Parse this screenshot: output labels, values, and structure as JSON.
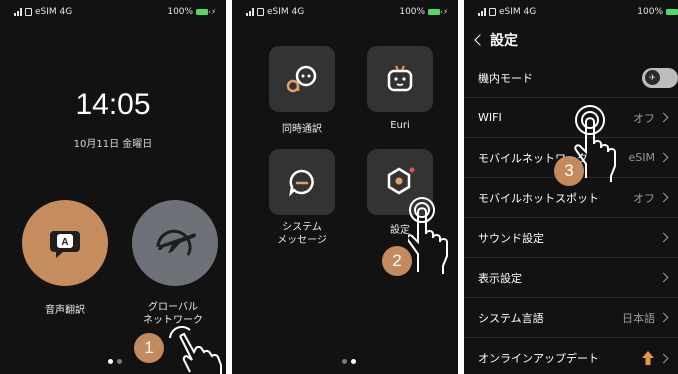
{
  "status": {
    "carrier": "eSIM 4G",
    "battery": "100%"
  },
  "screen1": {
    "time": "14:05",
    "date": "10月11日 金曜日",
    "apps": [
      {
        "label": "音声翻訳",
        "icon": "translate-bubble-icon"
      },
      {
        "label": "グローバル\nネットワーク",
        "icon": "airplane-globe-icon"
      }
    ],
    "step": "1"
  },
  "screen2": {
    "apps": [
      {
        "label": "同時通訳",
        "icon": "interpreter-icon"
      },
      {
        "label": "Euri",
        "icon": "robot-icon"
      },
      {
        "label": "システム\nメッセージ",
        "icon": "message-icon"
      },
      {
        "label": "設定",
        "icon": "hexagon-settings-icon"
      }
    ],
    "step": "2"
  },
  "screen3": {
    "back": "<",
    "title": "設定",
    "rows": [
      {
        "label": "機内モード",
        "value": ""
      },
      {
        "label": "WIFI",
        "value": "オフ"
      },
      {
        "label": "モバイルネットワーク",
        "value": "eSIM"
      },
      {
        "label": "モバイルホットスポット",
        "value": "オフ"
      },
      {
        "label": "サウンド設定",
        "value": ""
      },
      {
        "label": "表示設定",
        "value": ""
      },
      {
        "label": "システム言語",
        "value": "日本語"
      },
      {
        "label": "オンラインアップデート",
        "value": ""
      }
    ],
    "step": "3"
  },
  "colors": {
    "accent": "#cd9262",
    "tile": "#333333",
    "background": "#121212",
    "update_arrow": "#e39a3f"
  }
}
